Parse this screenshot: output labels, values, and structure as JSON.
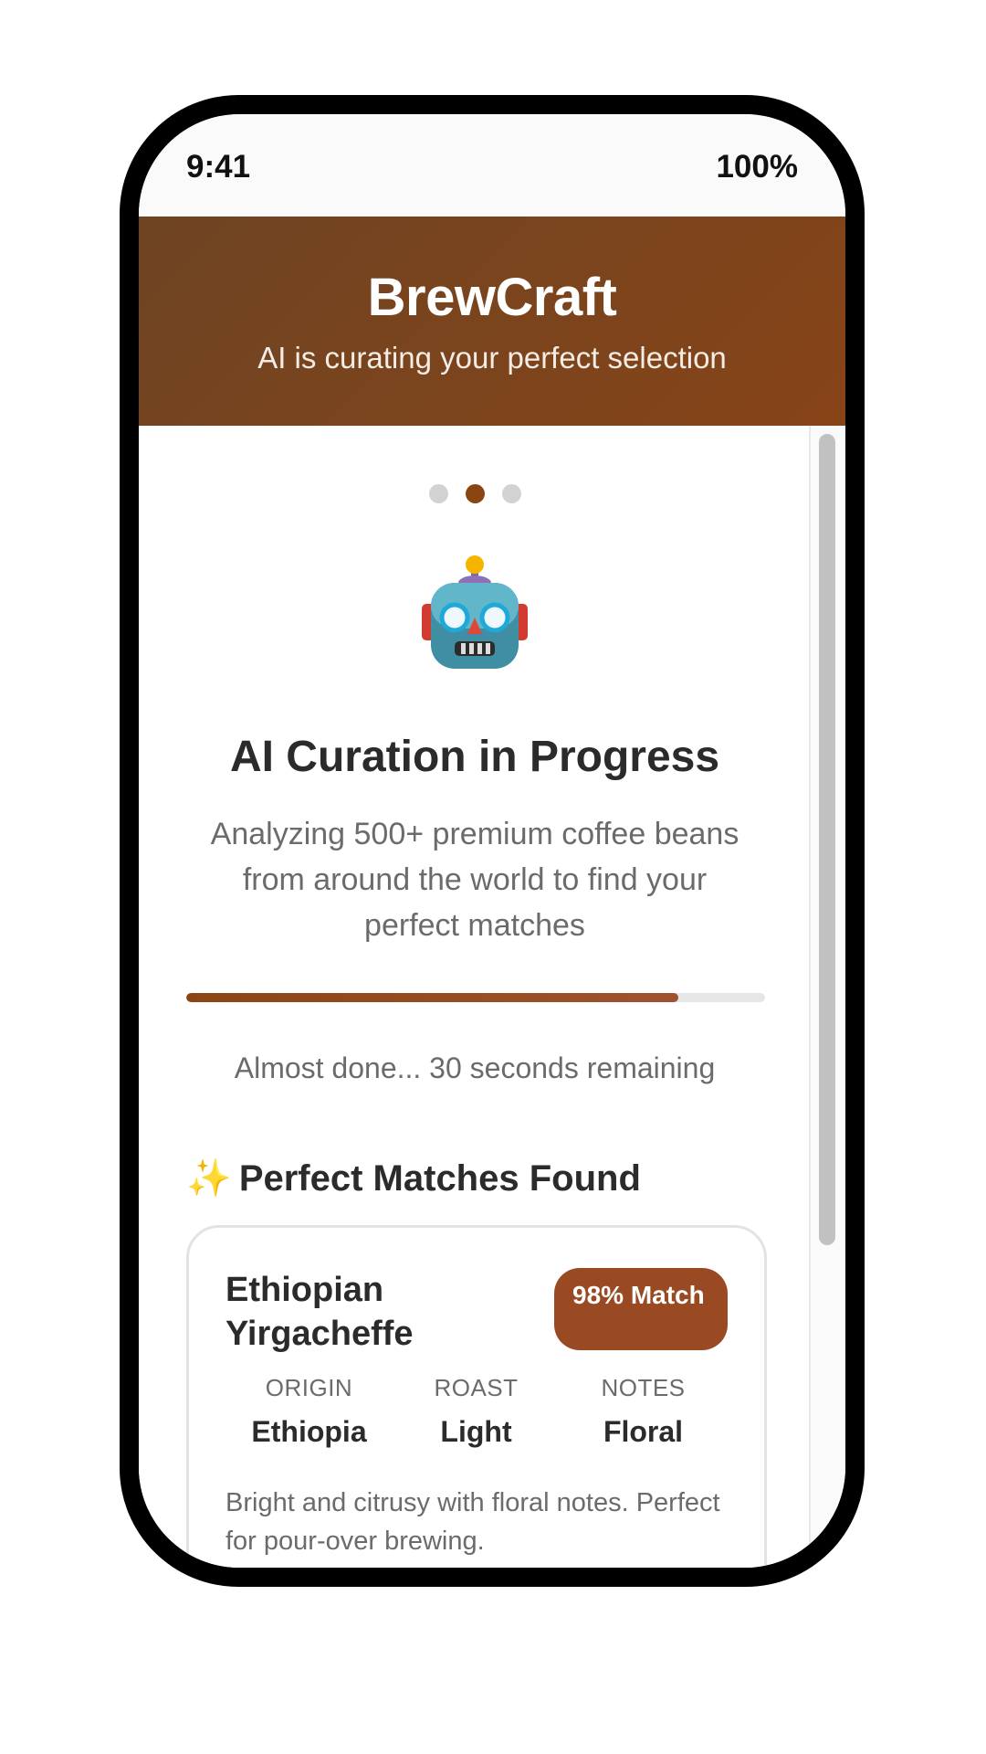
{
  "status_bar": {
    "time": "9:41",
    "battery": "100%"
  },
  "header": {
    "title": "BrewCraft",
    "subtitle": "AI is curating your perfect selection"
  },
  "pager": {
    "count": 3,
    "active_index": 1
  },
  "curation": {
    "icon": "robot-icon",
    "title": "AI Curation in Progress",
    "description": "Analyzing 500+ premium coffee beans from around the world to find your perfect matches",
    "progress_fraction": 0.85,
    "progress_label": "Almost done... 30 seconds remaining"
  },
  "matches": {
    "heading_icon": "✨",
    "heading": "Perfect Matches Found",
    "items": [
      {
        "name": "Ethiopian Yirgacheffe",
        "match": "98% Match",
        "attributes": [
          {
            "label": "ORIGIN",
            "value": "Ethiopia"
          },
          {
            "label": "ROAST",
            "value": "Light"
          },
          {
            "label": "NOTES",
            "value": "Floral"
          }
        ],
        "description": "Bright and citrusy with floral notes. Perfect for pour-over brewing."
      }
    ]
  },
  "colors": {
    "accent": "#8b4513",
    "header_start": "#6e4423",
    "header_end": "#874417",
    "badge": "#9a4a22"
  }
}
